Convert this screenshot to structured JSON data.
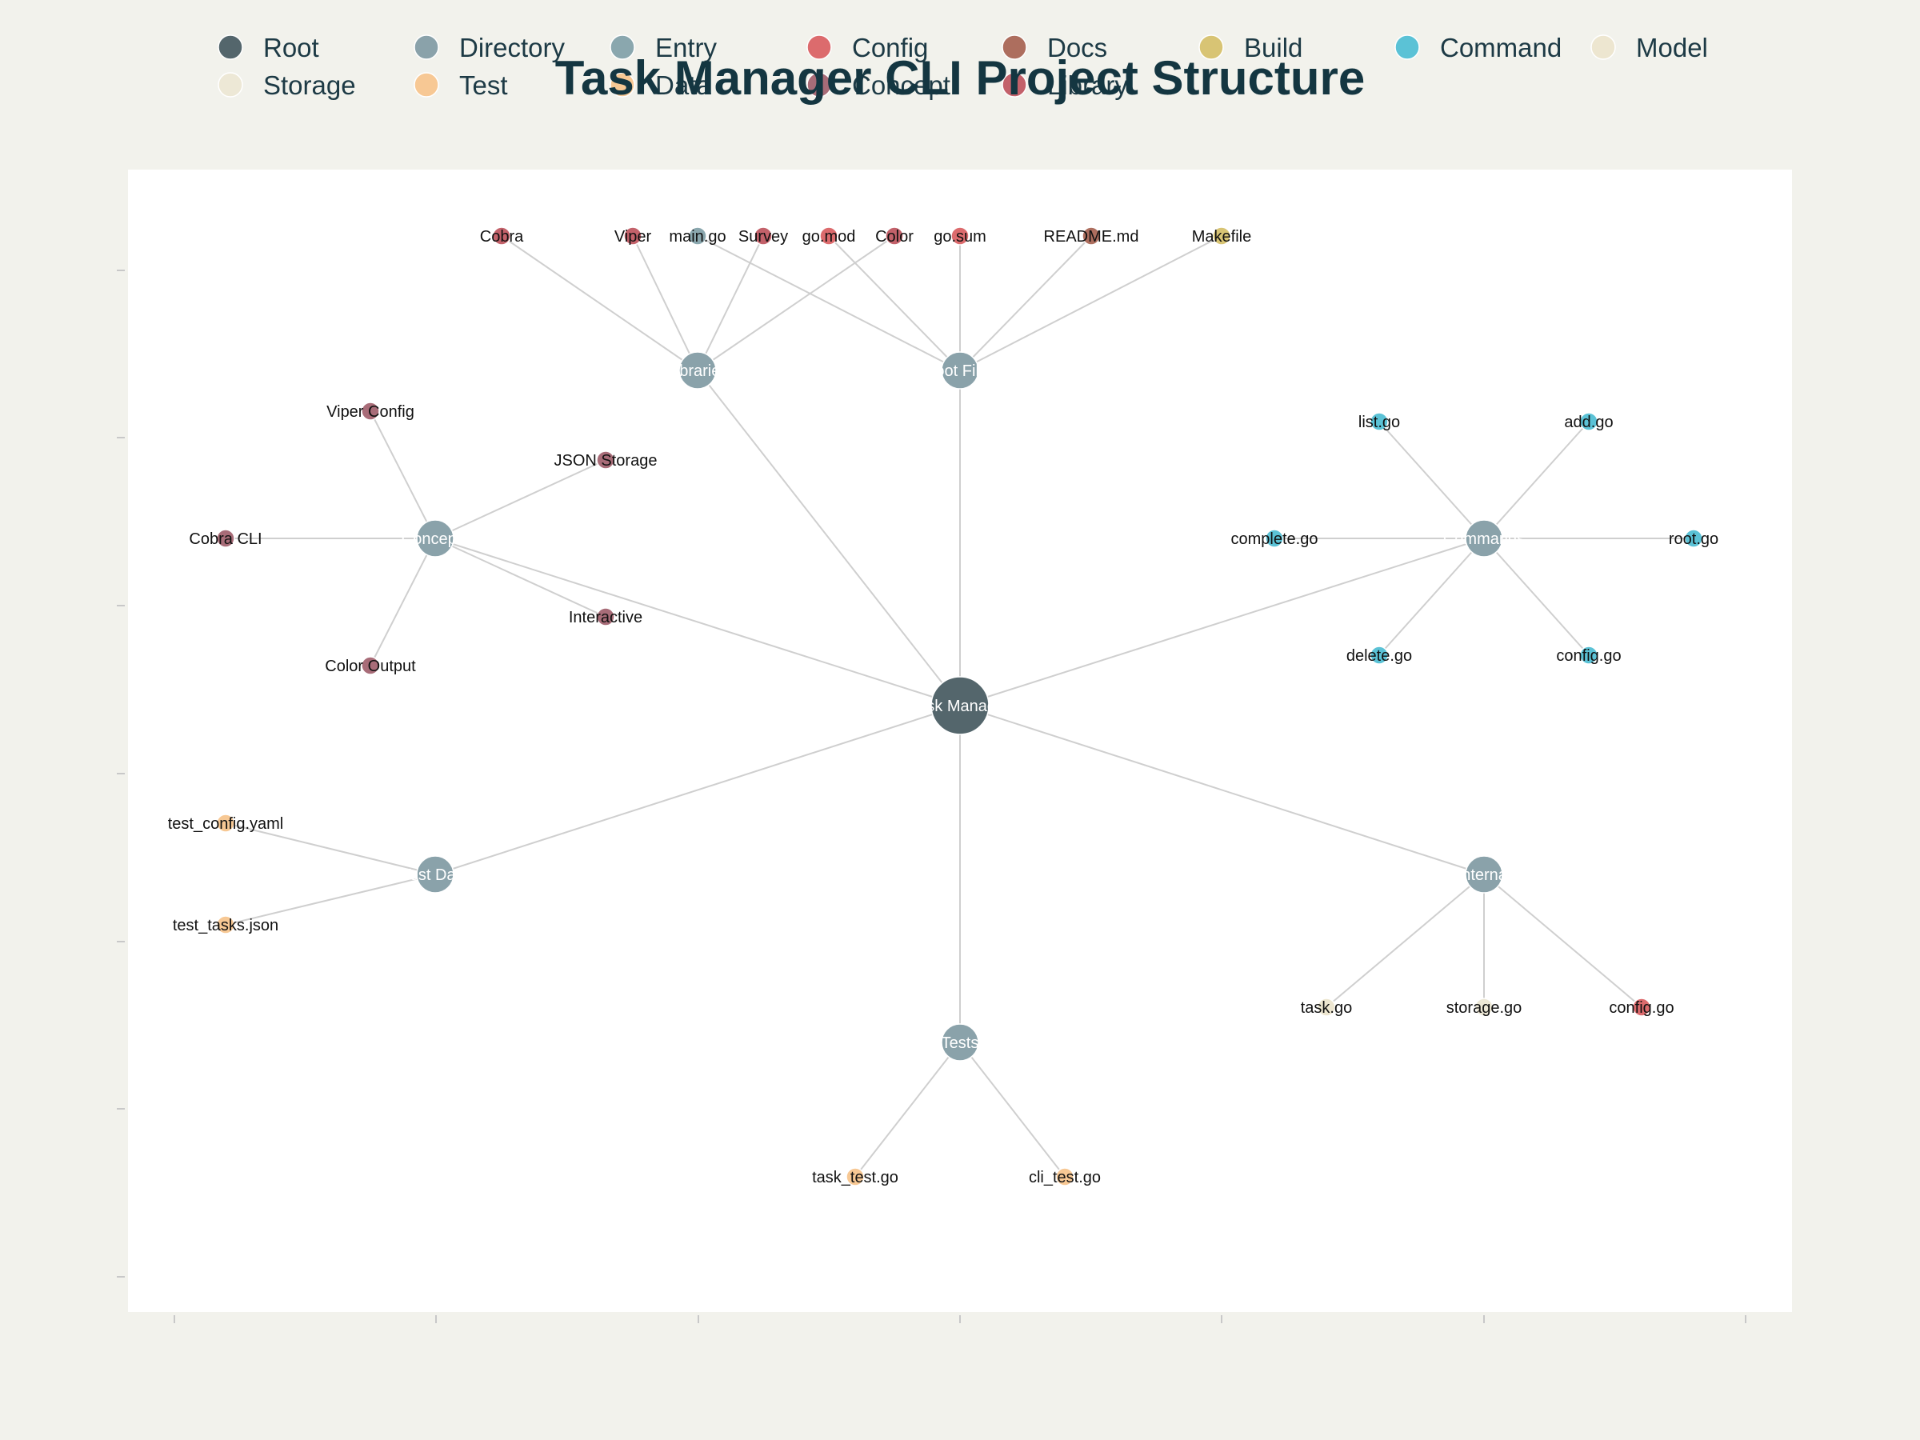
{
  "chart_data": {
    "type": "network",
    "title": "Task Manager CLI Project Structure",
    "legend": [
      {
        "name": "Root",
        "color": "#54666c"
      },
      {
        "name": "Directory",
        "color": "#8aa2aa"
      },
      {
        "name": "Entry",
        "color": "#8aa7ae"
      },
      {
        "name": "Config",
        "color": "#dc6b6d"
      },
      {
        "name": "Docs",
        "color": "#ad6e5e"
      },
      {
        "name": "Build",
        "color": "#d8c474"
      },
      {
        "name": "Command",
        "color": "#5bc2d6"
      },
      {
        "name": "Model",
        "color": "#ede6d0"
      },
      {
        "name": "Storage",
        "color": "#ede8d6"
      },
      {
        "name": "Test",
        "color": "#f7c894"
      },
      {
        "name": "Data",
        "color": "#f7c894"
      },
      {
        "name": "Concept",
        "color": "#a86c78"
      },
      {
        "name": "Library",
        "color": "#c3616a"
      }
    ],
    "nodes": [
      {
        "id": "root",
        "label": "Task Manager",
        "category": "Root"
      },
      {
        "id": "libs",
        "label": "Libraries",
        "category": "Directory"
      },
      {
        "id": "rootfiles",
        "label": "Root Files",
        "category": "Directory"
      },
      {
        "id": "concepts",
        "label": "Concepts",
        "category": "Directory"
      },
      {
        "id": "commands",
        "label": "Commands",
        "category": "Directory"
      },
      {
        "id": "testdata",
        "label": "Test Data",
        "category": "Directory"
      },
      {
        "id": "internal",
        "label": "Internal",
        "category": "Directory"
      },
      {
        "id": "tests",
        "label": "Tests",
        "category": "Directory"
      },
      {
        "id": "cobra",
        "label": "Cobra",
        "category": "Library"
      },
      {
        "id": "viper",
        "label": "Viper",
        "category": "Library"
      },
      {
        "id": "survey",
        "label": "Survey",
        "category": "Library"
      },
      {
        "id": "color",
        "label": "Color",
        "category": "Library"
      },
      {
        "id": "maingo",
        "label": "main.go",
        "category": "Entry"
      },
      {
        "id": "gomod",
        "label": "go.mod",
        "category": "Config"
      },
      {
        "id": "gosum",
        "label": "go.sum",
        "category": "Config"
      },
      {
        "id": "readme",
        "label": "README.md",
        "category": "Docs"
      },
      {
        "id": "makefile",
        "label": "Makefile",
        "category": "Build"
      },
      {
        "id": "viperconfig",
        "label": "Viper Config",
        "category": "Concept"
      },
      {
        "id": "jsonstorage",
        "label": "JSON Storage",
        "category": "Concept"
      },
      {
        "id": "cobracli",
        "label": "Cobra CLI",
        "category": "Concept"
      },
      {
        "id": "interactive",
        "label": "Interactive",
        "category": "Concept"
      },
      {
        "id": "coloroutput",
        "label": "Color Output",
        "category": "Concept"
      },
      {
        "id": "listgo",
        "label": "list.go",
        "category": "Command"
      },
      {
        "id": "addgo",
        "label": "add.go",
        "category": "Command"
      },
      {
        "id": "completego",
        "label": "complete.go",
        "category": "Command"
      },
      {
        "id": "rootgo",
        "label": "root.go",
        "category": "Command"
      },
      {
        "id": "deletego",
        "label": "delete.go",
        "category": "Command"
      },
      {
        "id": "configcmd",
        "label": "config.go",
        "category": "Command"
      },
      {
        "id": "testconfig",
        "label": "test_config.yaml",
        "category": "Data"
      },
      {
        "id": "testtasks",
        "label": "test_tasks.json",
        "category": "Data"
      },
      {
        "id": "taskgo",
        "label": "task.go",
        "category": "Model"
      },
      {
        "id": "storagego",
        "label": "storage.go",
        "category": "Storage"
      },
      {
        "id": "configint",
        "label": "config.go",
        "category": "Config"
      },
      {
        "id": "tasktest",
        "label": "task_test.go",
        "category": "Test"
      },
      {
        "id": "clitest",
        "label": "cli_test.go",
        "category": "Test"
      }
    ],
    "edges": [
      [
        "root",
        "libs"
      ],
      [
        "root",
        "rootfiles"
      ],
      [
        "root",
        "concepts"
      ],
      [
        "root",
        "commands"
      ],
      [
        "root",
        "testdata"
      ],
      [
        "root",
        "internal"
      ],
      [
        "root",
        "tests"
      ],
      [
        "libs",
        "cobra"
      ],
      [
        "libs",
        "viper"
      ],
      [
        "libs",
        "survey"
      ],
      [
        "libs",
        "color"
      ],
      [
        "rootfiles",
        "maingo"
      ],
      [
        "rootfiles",
        "gomod"
      ],
      [
        "rootfiles",
        "gosum"
      ],
      [
        "rootfiles",
        "readme"
      ],
      [
        "rootfiles",
        "makefile"
      ],
      [
        "concepts",
        "viperconfig"
      ],
      [
        "concepts",
        "jsonstorage"
      ],
      [
        "concepts",
        "cobracli"
      ],
      [
        "concepts",
        "interactive"
      ],
      [
        "concepts",
        "coloroutput"
      ],
      [
        "commands",
        "listgo"
      ],
      [
        "commands",
        "addgo"
      ],
      [
        "commands",
        "completego"
      ],
      [
        "commands",
        "rootgo"
      ],
      [
        "commands",
        "deletego"
      ],
      [
        "commands",
        "configcmd"
      ],
      [
        "testdata",
        "testconfig"
      ],
      [
        "testdata",
        "testtasks"
      ],
      [
        "internal",
        "taskgo"
      ],
      [
        "internal",
        "storagego"
      ],
      [
        "internal",
        "configint"
      ],
      [
        "tests",
        "tasktest"
      ],
      [
        "tests",
        "clitest"
      ]
    ]
  }
}
